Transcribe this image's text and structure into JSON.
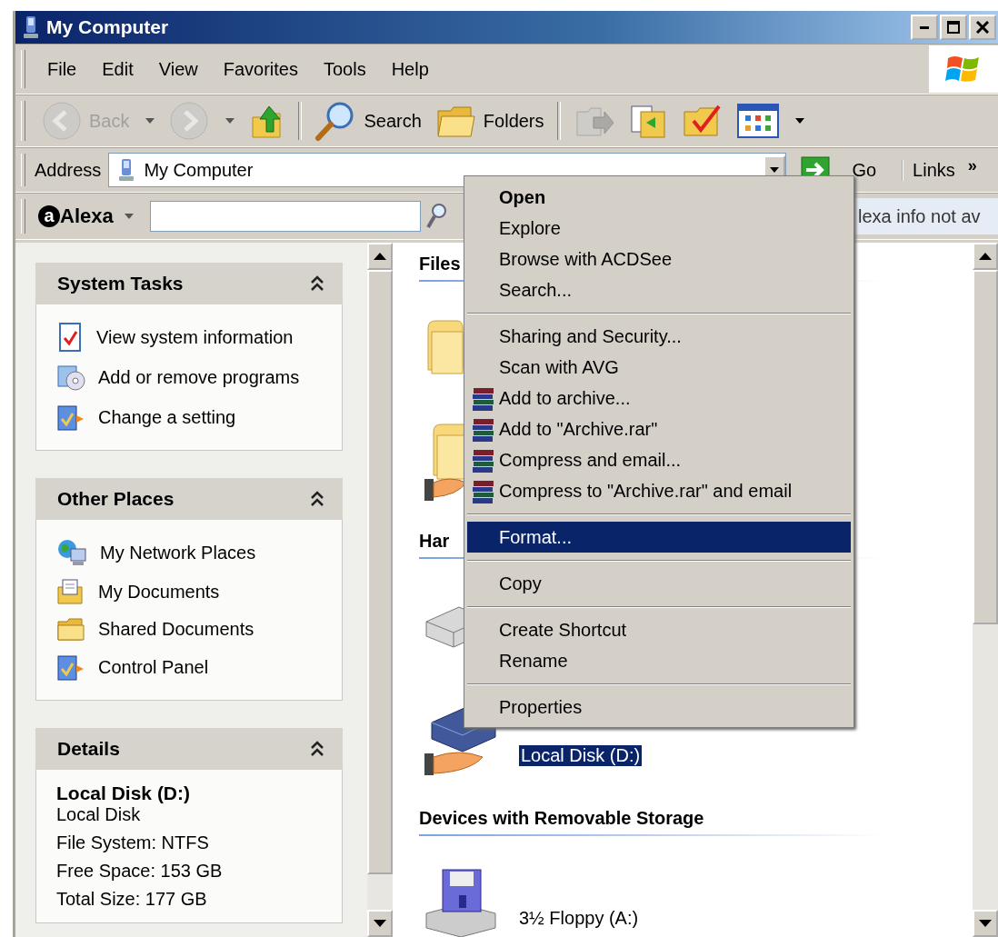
{
  "window": {
    "title": "My Computer"
  },
  "menu_bar": [
    "File",
    "Edit",
    "View",
    "Favorites",
    "Tools",
    "Help"
  ],
  "toolbar": [
    {
      "kind": "back",
      "label": "Back",
      "disabled": true
    },
    {
      "kind": "forward",
      "disabled": true
    },
    {
      "kind": "up",
      "disabled": false
    },
    {
      "kind": "separator"
    },
    {
      "kind": "search",
      "label": "Search",
      "disabled": false
    },
    {
      "kind": "folders",
      "label": "Folders",
      "disabled": false
    },
    {
      "kind": "separator"
    },
    {
      "kind": "move",
      "disabled": true
    },
    {
      "kind": "copy",
      "disabled": false
    },
    {
      "kind": "delete",
      "disabled": false
    },
    {
      "kind": "views",
      "disabled": false
    }
  ],
  "address_bar": {
    "label": "Address",
    "value": "My Computer",
    "go": "Go",
    "links": "Links",
    "links_more": "»"
  },
  "alexa_bar": {
    "logo_mark": "a",
    "brand": "Alexa",
    "status": "lexa info not av"
  },
  "side_panels": [
    {
      "kind": "tasks",
      "title": "System Tasks",
      "expanded": true,
      "items": [
        {
          "kind": "sysinfo",
          "label": "View system information"
        },
        {
          "kind": "addremove",
          "label": "Add or remove programs"
        },
        {
          "kind": "setting",
          "label": "Change a setting"
        }
      ]
    },
    {
      "kind": "tasks",
      "title": "Other Places",
      "expanded": true,
      "items": [
        {
          "kind": "network",
          "label": "My Network Places"
        },
        {
          "kind": "documents",
          "label": "My Documents"
        },
        {
          "kind": "folder",
          "label": "Shared Documents"
        },
        {
          "kind": "setting",
          "label": "Control Panel"
        }
      ]
    },
    {
      "kind": "details",
      "title": "Details",
      "expanded": true,
      "name": "Local Disk (D:)",
      "type": "Local Disk",
      "lines": [
        "File System: NTFS",
        "Free Space: 153 GB",
        "Total Size: 177 GB"
      ]
    }
  ],
  "sections": [
    {
      "title": "Files",
      "items": [
        {
          "kind": "folder",
          "selected": false
        },
        {
          "kind": "shared-folder",
          "selected": false
        }
      ]
    },
    {
      "title": "Har",
      "items": [
        {
          "kind": "drive",
          "selected": false
        },
        {
          "kind": "shared-drive",
          "label": "Local Disk (D:)",
          "selected": true
        }
      ]
    },
    {
      "title": "Devices with Removable Storage",
      "items": [
        {
          "kind": "floppy",
          "label": "3½ Floppy (A:)",
          "selected": false
        }
      ]
    }
  ],
  "context_menu": [
    {
      "kind": "item",
      "label": "Open",
      "default": true,
      "selected": false
    },
    {
      "kind": "item",
      "label": "Explore",
      "default": false,
      "selected": false
    },
    {
      "kind": "item",
      "label": "Browse with ACDSee",
      "default": false,
      "selected": false
    },
    {
      "kind": "item",
      "label": "Search...",
      "default": false,
      "selected": false
    },
    {
      "kind": "separator"
    },
    {
      "kind": "item",
      "label": "Sharing and Security...",
      "default": false,
      "selected": false
    },
    {
      "kind": "item",
      "label": "Scan with AVG",
      "default": false,
      "selected": false
    },
    {
      "kind": "archive",
      "label": "Add to archive...",
      "default": false,
      "selected": false
    },
    {
      "kind": "archive",
      "label": "Add to \"Archive.rar\"",
      "default": false,
      "selected": false
    },
    {
      "kind": "archive",
      "label": "Compress and email...",
      "default": false,
      "selected": false
    },
    {
      "kind": "archive",
      "label": "Compress to \"Archive.rar\" and email",
      "default": false,
      "selected": false
    },
    {
      "kind": "separator"
    },
    {
      "kind": "item",
      "label": "Format...",
      "default": false,
      "selected": true
    },
    {
      "kind": "separator"
    },
    {
      "kind": "item",
      "label": "Copy",
      "default": false,
      "selected": false
    },
    {
      "kind": "separator"
    },
    {
      "kind": "item",
      "label": "Create Shortcut",
      "default": false,
      "selected": false
    },
    {
      "kind": "item",
      "label": "Rename",
      "default": false,
      "selected": false
    },
    {
      "kind": "separator"
    },
    {
      "kind": "item",
      "label": "Properties",
      "default": false,
      "selected": false
    }
  ]
}
